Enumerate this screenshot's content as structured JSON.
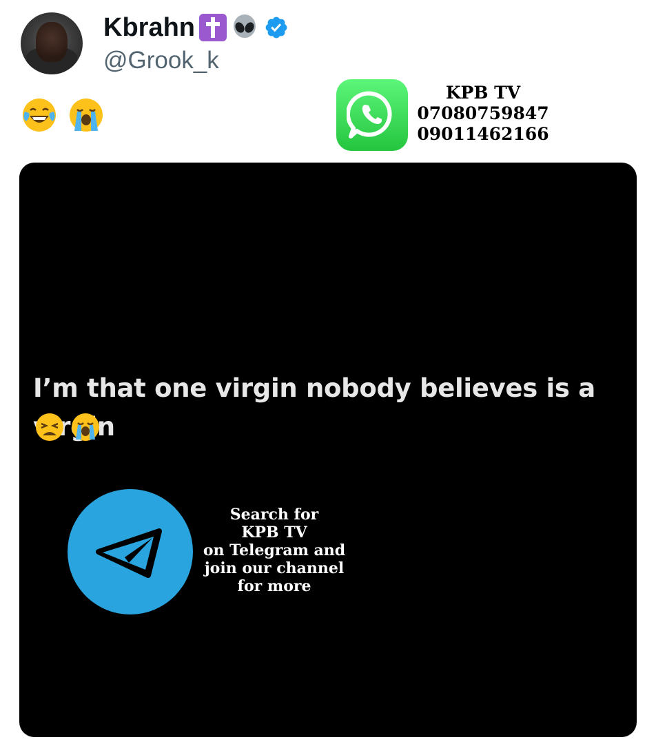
{
  "user": {
    "display_name": "Kbrahn",
    "handle": "@Grook_k",
    "name_emojis": [
      "latin-cross-emoji",
      "alien-emoji"
    ],
    "verified": true
  },
  "tweet": {
    "emojis": [
      "face-with-tears-of-joy",
      "loudly-crying-face"
    ]
  },
  "whatsapp_promo": {
    "brand": "KPB TV",
    "phone_1": "07080759847",
    "phone_2": "09011462166"
  },
  "media": {
    "caption": "I’m that one virgin nobody believes is a virgin",
    "caption_emojis": [
      "weary-face",
      "loudly-crying-face"
    ],
    "telegram_promo": {
      "line1": "Search for",
      "line2": "KPB TV",
      "line3": "on Telegram and",
      "line4": "join our channel",
      "line5": "for more"
    }
  },
  "colors": {
    "verified_blue": "#1d9bf0",
    "whatsapp_green": "#25c53f",
    "telegram_blue": "#2aa4df",
    "media_background": "#000000"
  }
}
